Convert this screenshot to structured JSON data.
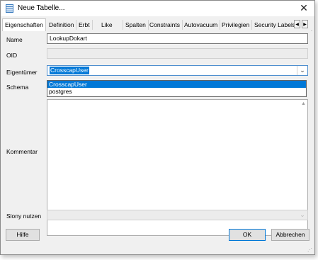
{
  "window": {
    "title": "Neue Tabelle..."
  },
  "tabs": [
    {
      "label": "Eigenschaften"
    },
    {
      "label": "Definition"
    },
    {
      "label": "Erbt"
    },
    {
      "label": "Like"
    },
    {
      "label": "Spalten"
    },
    {
      "label": "Constraints"
    },
    {
      "label": "Autovacuum"
    },
    {
      "label": "Privilegien"
    },
    {
      "label": "Security Labels"
    }
  ],
  "form": {
    "name_label": "Name",
    "name_value": "LookupDokart",
    "oid_label": "OID",
    "oid_value": "",
    "owner_label": "Eigentümer",
    "owner_value": "CrosscapUser",
    "owner_options": [
      "CrosscapUser",
      "postgres"
    ],
    "schema_label": "Schema",
    "comment_label": "Kommentar",
    "slony_label": "Slony nutzen"
  },
  "buttons": {
    "help": "Hilfe",
    "ok": "OK",
    "cancel": "Abbrechen"
  },
  "icons": {
    "title": "table-icon",
    "close": "close-icon",
    "combo": "chevron-down-icon",
    "tabs_left": "arrow-left-icon",
    "tabs_right": "arrow-right-icon"
  },
  "colors": {
    "selection": "#0078d7",
    "window_bg": "#f0f0f0"
  }
}
